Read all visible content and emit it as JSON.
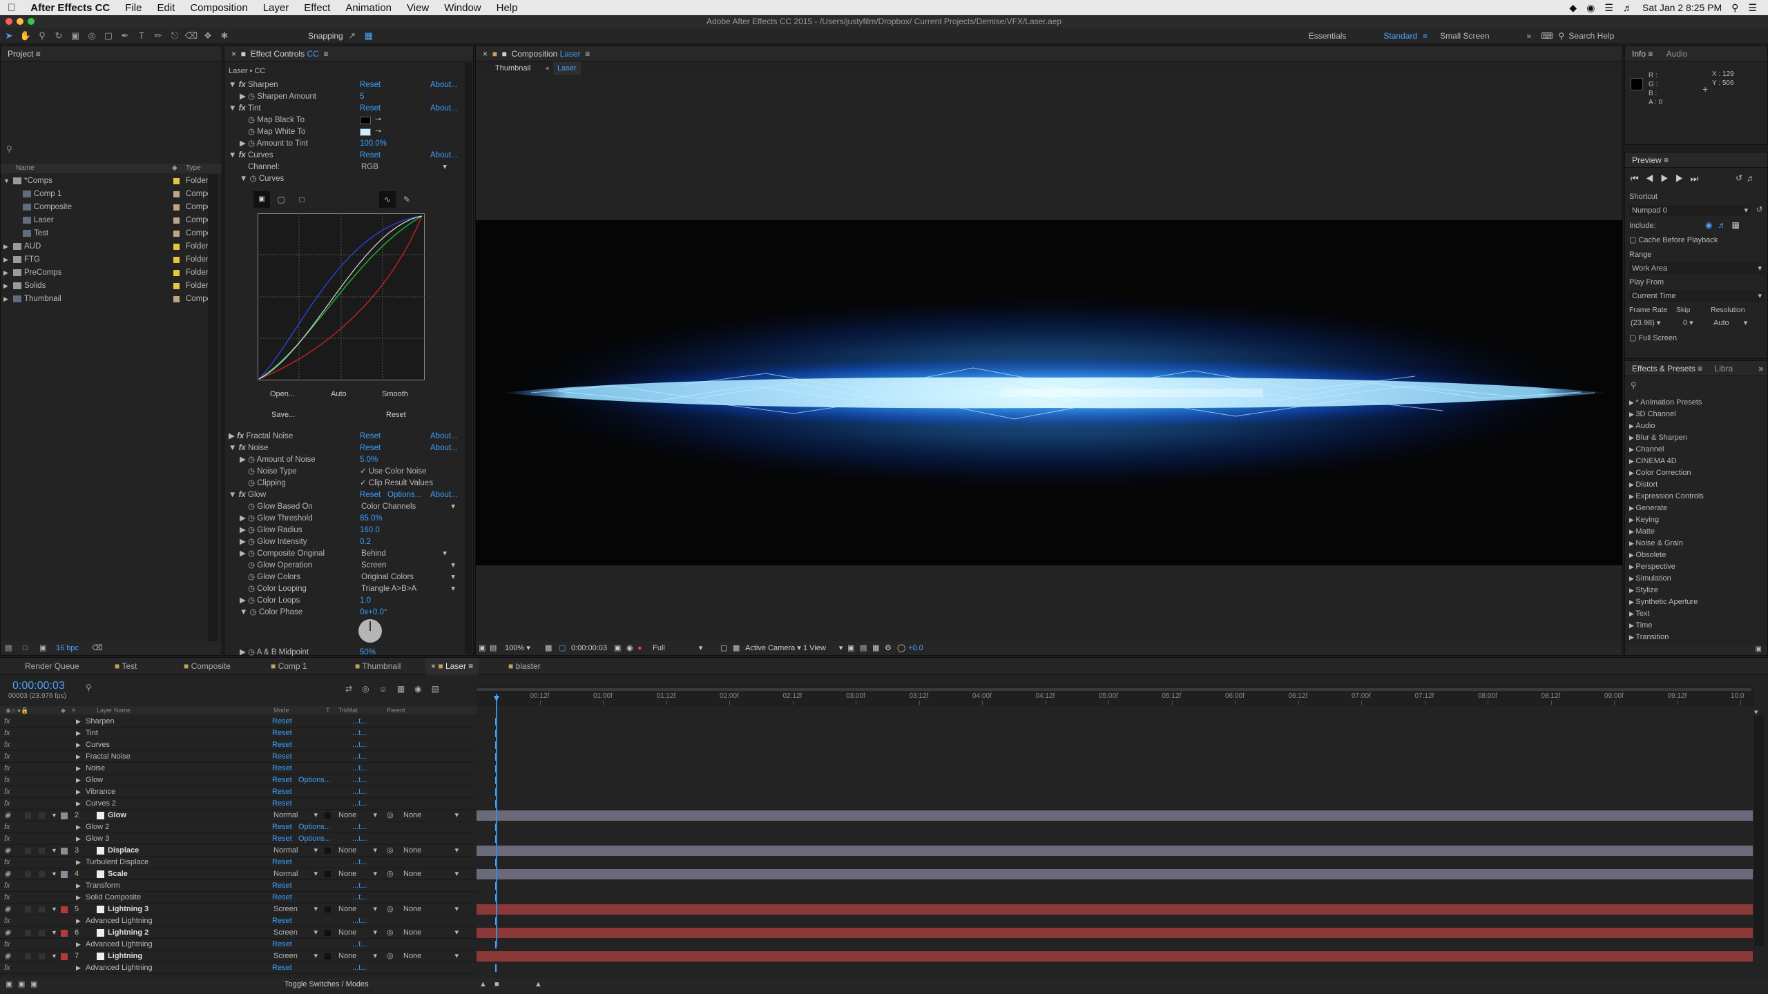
{
  "menubar": {
    "app": "After Effects CC",
    "items": [
      "File",
      "Edit",
      "Composition",
      "Layer",
      "Effect",
      "Animation",
      "View",
      "Window",
      "Help"
    ],
    "clock": "Sat Jan 2  8:25 PM"
  },
  "window": {
    "title": "Adobe After Effects CC 2015 - /Users/justyfilm/Dropbox/ Current Projects/Demise/VFX/Laser.aep"
  },
  "toolbar": {
    "snapping": "Snapping",
    "workspaces": [
      "Essentials",
      "Standard",
      "Small Screen"
    ],
    "active_workspace": "Standard",
    "search_placeholder": "Search Help"
  },
  "project": {
    "title": "Project",
    "col_name": "Name",
    "col_type": "Type",
    "bpc": "16 bpc",
    "items": [
      {
        "name": "*Comps",
        "type": "Folder",
        "color": "#e8c53a",
        "level": 0,
        "open": true
      },
      {
        "name": "Comp 1",
        "type": "Compo",
        "color": "#c3a386",
        "level": 1
      },
      {
        "name": "Composite",
        "type": "Compo",
        "color": "#c3a386",
        "level": 1
      },
      {
        "name": "Laser",
        "type": "Compo",
        "color": "#c3a386",
        "level": 1
      },
      {
        "name": "Test",
        "type": "Compo",
        "color": "#c3a386",
        "level": 1
      },
      {
        "name": "AUD",
        "type": "Folder",
        "color": "#e8c53a",
        "level": 0
      },
      {
        "name": "FTG",
        "type": "Folder",
        "color": "#e8c53a",
        "level": 0
      },
      {
        "name": "PreComps",
        "type": "Folder",
        "color": "#e8c53a",
        "level": 0
      },
      {
        "name": "Solids",
        "type": "Folder",
        "color": "#e8c53a",
        "level": 0
      },
      {
        "name": "Thumbnail",
        "type": "Compo",
        "color": "#c3a386",
        "level": 0
      }
    ]
  },
  "effects_controls": {
    "tab": "Effect Controls",
    "tab_name": "CC",
    "layer": "Laser • CC",
    "reset": "Reset",
    "about": "About...",
    "options": "Options...",
    "sharpen": {
      "name": "Sharpen",
      "amount_label": "Sharpen Amount",
      "amount": "5"
    },
    "tint": {
      "name": "Tint",
      "map_black": "Map Black To",
      "map_white": "Map White To",
      "amount_label": "Amount to Tint",
      "amount": "100.0%"
    },
    "curves": {
      "name": "Curves",
      "channel_label": "Channel:",
      "channel": "RGB",
      "sub": "Curves",
      "open": "Open...",
      "auto": "Auto",
      "smooth": "Smooth",
      "save": "Save...",
      "reset": "Reset"
    },
    "fractal": {
      "name": "Fractal Noise"
    },
    "noise": {
      "name": "Noise",
      "amount_label": "Amount of Noise",
      "amount": "5.0%",
      "type_label": "Noise Type",
      "type_val": "Use Color Noise",
      "clip_label": "Clipping",
      "clip_val": "Clip Result Values"
    },
    "glow": {
      "name": "Glow",
      "based_label": "Glow Based On",
      "based": "Color Channels",
      "threshold_label": "Glow Threshold",
      "threshold": "85.0%",
      "radius_label": "Glow Radius",
      "radius": "160.0",
      "intensity_label": "Glow Intensity",
      "intensity": "0.2",
      "comp_label": "Composite Original",
      "comp": "Behind",
      "op_label": "Glow Operation",
      "op": "Screen",
      "colors_label": "Glow Colors",
      "colors": "Original Colors",
      "loop_label": "Color Looping",
      "loop": "Triangle A>B>A",
      "loops_label": "Color Loops",
      "loops": "1.0",
      "phase_label": "Color Phase",
      "phase": "0x+0.0°",
      "mid_label": "A & B Midpoint",
      "mid": "50%"
    }
  },
  "composition": {
    "tab": "Composition",
    "tab_name": "Laser",
    "breadcrumbs": [
      "Thumbnail",
      "Laser"
    ],
    "zoom": "100%",
    "timecode": "0:00:00:03",
    "resolution": "Full",
    "camera": "Active Camera",
    "views": "1 View",
    "exposure": "+0.0"
  },
  "info": {
    "tab": "Info",
    "tab2": "Audio",
    "r": "R :",
    "g": "G :",
    "b": "B :",
    "a": "A : 0",
    "x": "X : 129",
    "y": "Y : 506"
  },
  "preview": {
    "tab": "Preview",
    "shortcut_label": "Shortcut",
    "shortcut": "Numpad 0",
    "include_label": "Include:",
    "cache": "Cache Before Playback",
    "range_label": "Range",
    "range": "Work Area",
    "play_from_label": "Play From",
    "play_from": "Current Time",
    "fr_label": "Frame Rate",
    "skip_label": "Skip",
    "res_label": "Resolution",
    "fr": "(23.98)",
    "skip": "0",
    "res": "Auto",
    "full_screen": "Full Screen"
  },
  "effects_presets": {
    "tab": "Effects & Presets",
    "tab2": "Libra",
    "items": [
      "* Animation Presets",
      "3D Channel",
      "Audio",
      "Blur & Sharpen",
      "Channel",
      "CINEMA 4D",
      "Color Correction",
      "Distort",
      "Expression Controls",
      "Generate",
      "Keying",
      "Matte",
      "Noise & Grain",
      "Obsolete",
      "Perspective",
      "Simulation",
      "Stylize",
      "Synthetic Aperture",
      "Text",
      "Time",
      "Transition"
    ]
  },
  "timeline": {
    "tabs": [
      "Render Queue",
      "Test",
      "Composite",
      "Comp 1",
      "Thumbnail",
      "Laser",
      "blaster"
    ],
    "active_tab": "Laser",
    "timecode": "0:00:00:03",
    "fps": "00003 (23.976 fps)",
    "col_layer": "Layer Name",
    "col_mode": "Mode",
    "col_t": "T",
    "col_trk": "TrkMat",
    "col_parent": "Parent",
    "toggle": "Toggle Switches / Modes",
    "ruler": [
      "00:12f",
      "01:00f",
      "01:12f",
      "02:00f",
      "02:12f",
      "03:00f",
      "03:12f",
      "04:00f",
      "04:12f",
      "05:00f",
      "05:12f",
      "06:00f",
      "06:12f",
      "07:00f",
      "07:12f",
      "08:00f",
      "08:12f",
      "09:00f",
      "09:12f",
      "10:0"
    ],
    "rows": [
      {
        "kind": "fx",
        "name": "Sharpen",
        "reset": "Reset",
        "dots": "...t..."
      },
      {
        "kind": "fx",
        "name": "Tint",
        "reset": "Reset",
        "dots": "...t..."
      },
      {
        "kind": "fx",
        "name": "Curves",
        "reset": "Reset",
        "dots": "...t..."
      },
      {
        "kind": "fx",
        "name": "Fractal Noise",
        "reset": "Reset",
        "dots": "...t..."
      },
      {
        "kind": "fx",
        "name": "Noise",
        "reset": "Reset",
        "dots": "...t..."
      },
      {
        "kind": "fx",
        "name": "Glow",
        "reset": "Reset",
        "options": "Options...",
        "dots": "...t..."
      },
      {
        "kind": "fx",
        "name": "Vibrance",
        "reset": "Reset",
        "dots": "...t..."
      },
      {
        "kind": "fx",
        "name": "Curves 2",
        "reset": "Reset",
        "dots": "...t..."
      },
      {
        "kind": "layer",
        "num": "2",
        "name": "Glow",
        "mode": "Normal",
        "trk": "None",
        "parent": "None",
        "label": "#8a8a9a",
        "bar": "#6a6a7a"
      },
      {
        "kind": "fx",
        "name": "Glow 2",
        "reset": "Reset",
        "options": "Options...",
        "dots": "...t..."
      },
      {
        "kind": "fx",
        "name": "Glow 3",
        "reset": "Reset",
        "options": "Options...",
        "dots": "...t..."
      },
      {
        "kind": "layer",
        "num": "3",
        "name": "Displace",
        "mode": "Normal",
        "trk": "None",
        "parent": "None",
        "label": "#8a8a9a",
        "bar": "#6a6a7a"
      },
      {
        "kind": "fx",
        "name": "Turbulent Displace",
        "reset": "Reset",
        "dots": "...t..."
      },
      {
        "kind": "layer",
        "num": "4",
        "name": "Scale",
        "mode": "Normal",
        "trk": "None",
        "parent": "None",
        "label": "#8a8a9a",
        "bar": "#6a6a7a"
      },
      {
        "kind": "fx",
        "name": "Transform",
        "reset": "Reset",
        "dots": "...t..."
      },
      {
        "kind": "fx",
        "name": "Solid Composite",
        "reset": "Reset",
        "dots": "...t..."
      },
      {
        "kind": "layer",
        "num": "5",
        "name": "Lightning 3",
        "mode": "Screen",
        "trk": "None",
        "parent": "None",
        "label": "#b23a3a",
        "bar": "#8a3838"
      },
      {
        "kind": "fx",
        "name": "Advanced Lightning",
        "reset": "Reset",
        "dots": "...t..."
      },
      {
        "kind": "layer",
        "num": "6",
        "name": "Lightning 2",
        "mode": "Screen",
        "trk": "None",
        "parent": "None",
        "label": "#b23a3a",
        "bar": "#8a3838"
      },
      {
        "kind": "fx",
        "name": "Advanced Lightning",
        "reset": "Reset",
        "dots": "...t..."
      },
      {
        "kind": "layer",
        "num": "7",
        "name": "Lightning",
        "mode": "Screen",
        "trk": "None",
        "parent": "None",
        "label": "#b23a3a",
        "bar": "#8a3838"
      },
      {
        "kind": "fx",
        "name": "Advanced Lightning",
        "reset": "Reset",
        "dots": "...t..."
      }
    ]
  }
}
